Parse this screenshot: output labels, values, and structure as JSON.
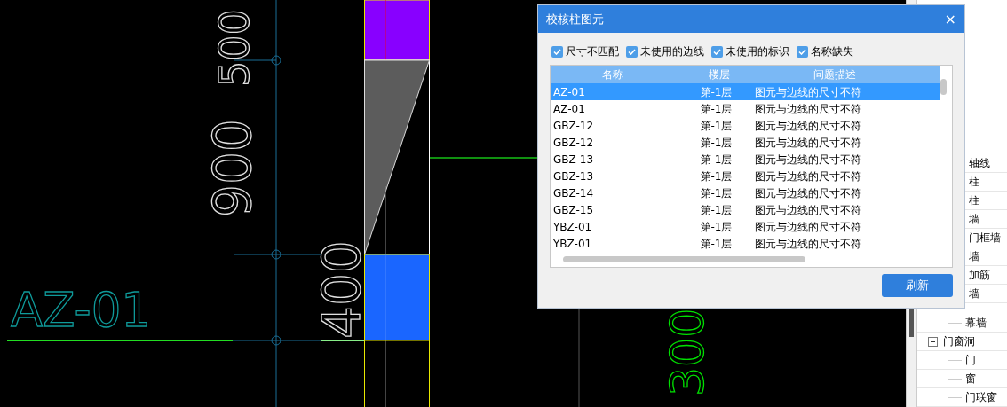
{
  "drawing": {
    "labels": [
      {
        "kind": "dimension",
        "text": "500"
      },
      {
        "kind": "dimension",
        "text": "900"
      },
      {
        "kind": "dimension",
        "text": "400"
      },
      {
        "kind": "name",
        "text": "AZ-01"
      },
      {
        "kind": "elevation",
        "text": "300"
      }
    ]
  },
  "tree": {
    "partly_covered_items": [
      {
        "label": "轴线"
      },
      {
        "label": "柱"
      },
      {
        "label": "柱"
      },
      {
        "label": "墙"
      },
      {
        "label": "门框墙"
      },
      {
        "label": "墙"
      },
      {
        "label": "加筋"
      },
      {
        "label": "墙"
      }
    ],
    "items": [
      {
        "label": "幕墙"
      },
      {
        "label": "门窗洞",
        "expanded": true,
        "children": [
          {
            "label": "门"
          },
          {
            "label": "窗"
          },
          {
            "label": "门联窗"
          }
        ]
      }
    ]
  },
  "dialog": {
    "title": "校核柱图元",
    "close": "×",
    "filters": [
      {
        "label": "尺寸不匹配",
        "checked": true
      },
      {
        "label": "未使用的边线",
        "checked": true
      },
      {
        "label": "未使用的标识",
        "checked": true
      },
      {
        "label": "名称缺失",
        "checked": true
      }
    ],
    "table": {
      "columns": [
        "名称",
        "楼层",
        "问题描述"
      ],
      "rows": [
        {
          "cells": [
            "AZ-01",
            "第-1层",
            "图元与边线的尺寸不符"
          ],
          "selected": true
        },
        {
          "cells": [
            "AZ-01",
            "第-1层",
            "图元与边线的尺寸不符"
          ],
          "selected": false
        },
        {
          "cells": [
            "GBZ-12",
            "第-1层",
            "图元与边线的尺寸不符"
          ],
          "selected": false
        },
        {
          "cells": [
            "GBZ-12",
            "第-1层",
            "图元与边线的尺寸不符"
          ],
          "selected": false
        },
        {
          "cells": [
            "GBZ-13",
            "第-1层",
            "图元与边线的尺寸不符"
          ],
          "selected": false
        },
        {
          "cells": [
            "GBZ-13",
            "第-1层",
            "图元与边线的尺寸不符"
          ],
          "selected": false
        },
        {
          "cells": [
            "GBZ-14",
            "第-1层",
            "图元与边线的尺寸不符"
          ],
          "selected": false
        },
        {
          "cells": [
            "GBZ-15",
            "第-1层",
            "图元与边线的尺寸不符"
          ],
          "selected": false
        },
        {
          "cells": [
            "YBZ-01",
            "第-1层",
            "图元与边线的尺寸不符"
          ],
          "selected": false
        },
        {
          "cells": [
            "YBZ-01",
            "第-1层",
            "图元与边线的尺寸不符"
          ],
          "selected": false
        }
      ]
    },
    "button": "刷新"
  }
}
